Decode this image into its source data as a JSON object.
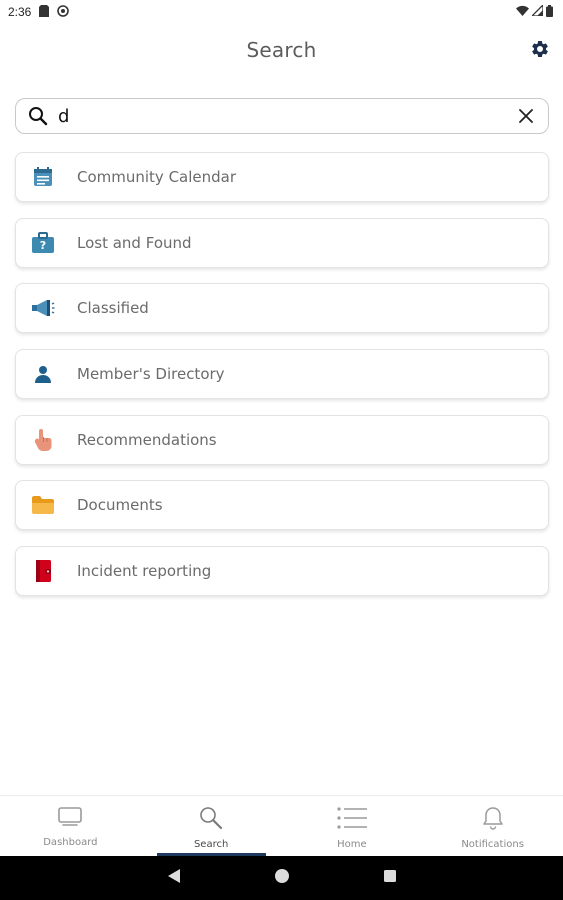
{
  "status_bar": {
    "time": "2:36"
  },
  "header": {
    "title": "Search"
  },
  "search": {
    "value": "d",
    "placeholder": ""
  },
  "results": [
    {
      "label": "Community Calendar",
      "icon": "calendar-icon",
      "color": "#4a90b8"
    },
    {
      "label": "Lost and Found",
      "icon": "lost-found-icon",
      "color": "#3d8ab0"
    },
    {
      "label": "Classified",
      "icon": "megaphone-icon",
      "color": "#2f6f9f"
    },
    {
      "label": "Member's Directory",
      "icon": "person-icon",
      "color": "#1f5f8b"
    },
    {
      "label": "Recommendations",
      "icon": "hand-pointer-icon",
      "color": "#e8937a"
    },
    {
      "label": "Documents",
      "icon": "folder-icon",
      "color": "#f5a623"
    },
    {
      "label": "Incident reporting",
      "icon": "report-book-icon",
      "color": "#d0021b"
    }
  ],
  "bottom_nav": [
    {
      "label": "Dashboard",
      "icon": "dashboard-icon",
      "active": false
    },
    {
      "label": "Search",
      "icon": "search-icon",
      "active": true
    },
    {
      "label": "Home",
      "icon": "list-icon",
      "active": false
    },
    {
      "label": "Notifications",
      "icon": "bell-icon",
      "active": false
    }
  ],
  "colors": {
    "accent": "#1e3a5f",
    "nav_active_bar": "#1e3a5f"
  }
}
